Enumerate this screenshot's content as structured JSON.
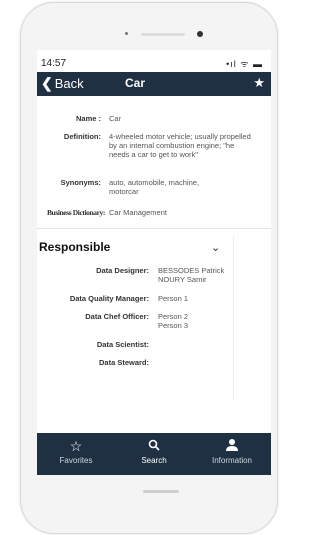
{
  "status": {
    "time": "14:57",
    "system_icons": "•ıl ᯤ ▬"
  },
  "navbar": {
    "back_label": "Back",
    "title": "Car",
    "star_icon": "star-icon"
  },
  "details": {
    "name_label": "Name :",
    "name_value": "Car",
    "definition_label": "Definition:",
    "definition_value": "4-wheeled motor vehicle; usually propelled by an internal combustion engine; \"he needs a car to get to work\"",
    "synonyms_label": "Synonyms:",
    "synonyms_value": "auto, automobile, machine, motorcar",
    "business_label": "Business Dictionary:",
    "business_value": "Car Management"
  },
  "responsible": {
    "title": "Responsible",
    "items": [
      {
        "label": "Data Designer:",
        "value": "BESSODES Patrick\nNOURY Samir"
      },
      {
        "label": "Data Quality Manager:",
        "value": "Person 1"
      },
      {
        "label": "Data Chef Officer:",
        "value": "Person 2\nPerson 3"
      },
      {
        "label": "Data Scientist:",
        "value": ""
      },
      {
        "label": "Data Steward:",
        "value": ""
      }
    ]
  },
  "tabs": [
    {
      "label": "Favorites",
      "icon": "star-outline-icon"
    },
    {
      "label": "Search",
      "icon": "search-icon"
    },
    {
      "label": "Information",
      "icon": "user-icon"
    }
  ],
  "colors": {
    "navbar": "#1f3042",
    "tabbar": "#1f3042"
  }
}
